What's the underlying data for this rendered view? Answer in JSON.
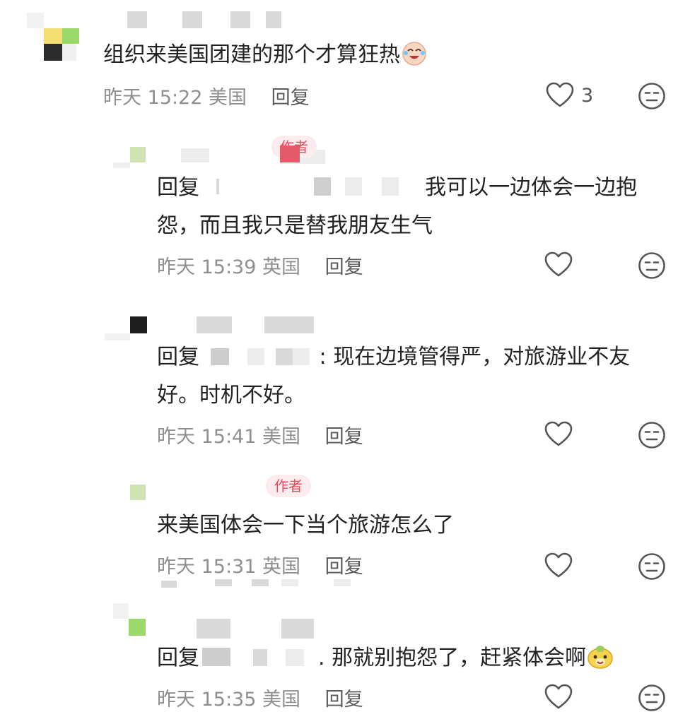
{
  "comments": [
    {
      "text": "组织来美国团建的那个才算狂热",
      "time": "昨天 15:22",
      "region": "美国",
      "reply_label": "回复",
      "likes": "3"
    },
    {
      "text_line1": "我可以一边体会一边抱",
      "text_line2": "怨，而且我只是替我朋友生气",
      "prefix": "回复",
      "badge": "作者",
      "time": "昨天 15:39",
      "region": "英国",
      "reply_label": "回复"
    },
    {
      "text_line1": ": 现在边境管得严，对旅游业不友",
      "text_line2": "好。时机不好。",
      "prefix": "回复",
      "time": "昨天 15:41",
      "region": "美国",
      "reply_label": "回复"
    },
    {
      "text": "来美国体会一下当个旅游怎么了",
      "badge": "作者",
      "time": "昨天 15:31",
      "region": "英国",
      "reply_label": "回复"
    },
    {
      "text": ". 那就别抱怨了，赶紧体会啊",
      "prefix": "回复",
      "time": "昨天 15:35",
      "region": "美国",
      "reply_label": "回复"
    }
  ],
  "icons": {
    "like": "heart-outline-icon",
    "dislike": "meh-face-icon"
  },
  "colors": {
    "badge_text": "#e94b5c",
    "badge_bg": "#fdecee",
    "meta_text": "#8f8f8f"
  }
}
